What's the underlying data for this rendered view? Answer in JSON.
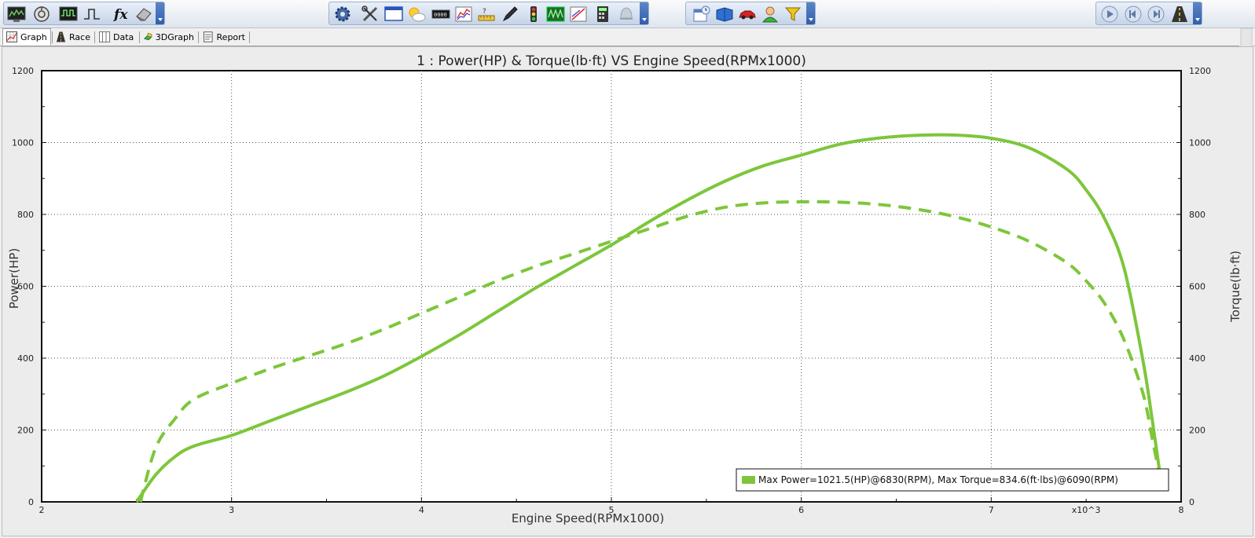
{
  "toolbar": {
    "groups": [
      {
        "id": "file",
        "buttons": [
          "monitor-icon",
          "refresh-dial-icon",
          "scope-icon",
          "pulse-icon",
          "function-icon",
          "eraser-icon"
        ]
      },
      {
        "id": "tools",
        "buttons": [
          "gear-icon",
          "tools-icon",
          "window-icon",
          "weather-icon",
          "display-icon",
          "chart-icon",
          "ruler-icon",
          "pen-icon",
          "traffic-light-icon",
          "waveform-icon",
          "graph-edit-icon",
          "calculator-icon",
          "bell-icon"
        ]
      },
      {
        "id": "data",
        "buttons": [
          "calendar-icon",
          "book-icon",
          "car-icon",
          "user-icon",
          "filter-icon"
        ]
      },
      {
        "id": "playback",
        "buttons": [
          "play-icon",
          "previous-icon",
          "next-icon",
          "road-icon"
        ]
      }
    ]
  },
  "tabs": [
    {
      "id": "graph",
      "label": "Graph",
      "active": true
    },
    {
      "id": "race",
      "label": "Race",
      "active": false
    },
    {
      "id": "data",
      "label": "Data",
      "active": false
    },
    {
      "id": "3dgraph",
      "label": "3DGraph",
      "active": false
    },
    {
      "id": "report",
      "label": "Report",
      "active": false
    }
  ],
  "chart_data": {
    "type": "line",
    "title": "1 : Power(HP) & Torque(lb·ft) VS Engine Speed(RPMx1000)",
    "xlabel": "Engine Speed(RPMx1000)",
    "ylabel_left": "Power(HP)",
    "ylabel_right": "Torque(lb·ft)",
    "x_multiplier": "x10^3",
    "xlim": [
      2,
      8
    ],
    "ylim": [
      0,
      1200
    ],
    "x_ticks": [
      "2",
      "3",
      "4",
      "5",
      "6",
      "7",
      "8"
    ],
    "y_ticks": [
      "0",
      "200",
      "400",
      "600",
      "800",
      "1000",
      "1200"
    ],
    "grid": true,
    "legend_position": "bottom-right",
    "legend_text": "Max Power=1021.5(HP)@6830(RPM), Max Torque=834.6(ft·lbs)@6090(RPM)",
    "colors": {
      "series": "#7dc63b",
      "plot_bg": "#ffffff",
      "panel_bg": "#ececec"
    },
    "series": [
      {
        "style": "solid",
        "axis": "left",
        "x": [
          2.5,
          2.6,
          2.7,
          2.8,
          3.0,
          3.2,
          3.4,
          3.6,
          3.8,
          4.0,
          4.2,
          4.4,
          4.6,
          4.8,
          5.0,
          5.2,
          5.4,
          5.6,
          5.8,
          6.0,
          6.2,
          6.4,
          6.6,
          6.8,
          7.0,
          7.2,
          7.4,
          7.5,
          7.6,
          7.7,
          7.8,
          7.85,
          7.9
        ],
        "y": [
          0,
          75,
          125,
          155,
          185,
          225,
          265,
          305,
          350,
          405,
          465,
          530,
          595,
          655,
          715,
          780,
          840,
          893,
          935,
          965,
          995,
          1012,
          1020,
          1021,
          1012,
          985,
          925,
          868,
          785,
          650,
          390,
          220,
          35
        ]
      },
      {
        "style": "dashed",
        "axis": "right",
        "x": [
          2.52,
          2.6,
          2.7,
          2.8,
          3.0,
          3.2,
          3.4,
          3.6,
          3.8,
          4.0,
          4.2,
          4.4,
          4.6,
          4.8,
          5.0,
          5.2,
          5.4,
          5.6,
          5.8,
          6.0,
          6.2,
          6.4,
          6.6,
          6.8,
          7.0,
          7.2,
          7.4,
          7.5,
          7.6,
          7.7,
          7.8,
          7.85,
          7.9
        ],
        "y": [
          0,
          150,
          230,
          285,
          330,
          370,
          405,
          440,
          480,
          525,
          570,
          615,
          655,
          690,
          725,
          760,
          795,
          820,
          832,
          835,
          834,
          828,
          815,
          795,
          765,
          725,
          665,
          615,
          550,
          450,
          300,
          170,
          40
        ]
      }
    ]
  }
}
